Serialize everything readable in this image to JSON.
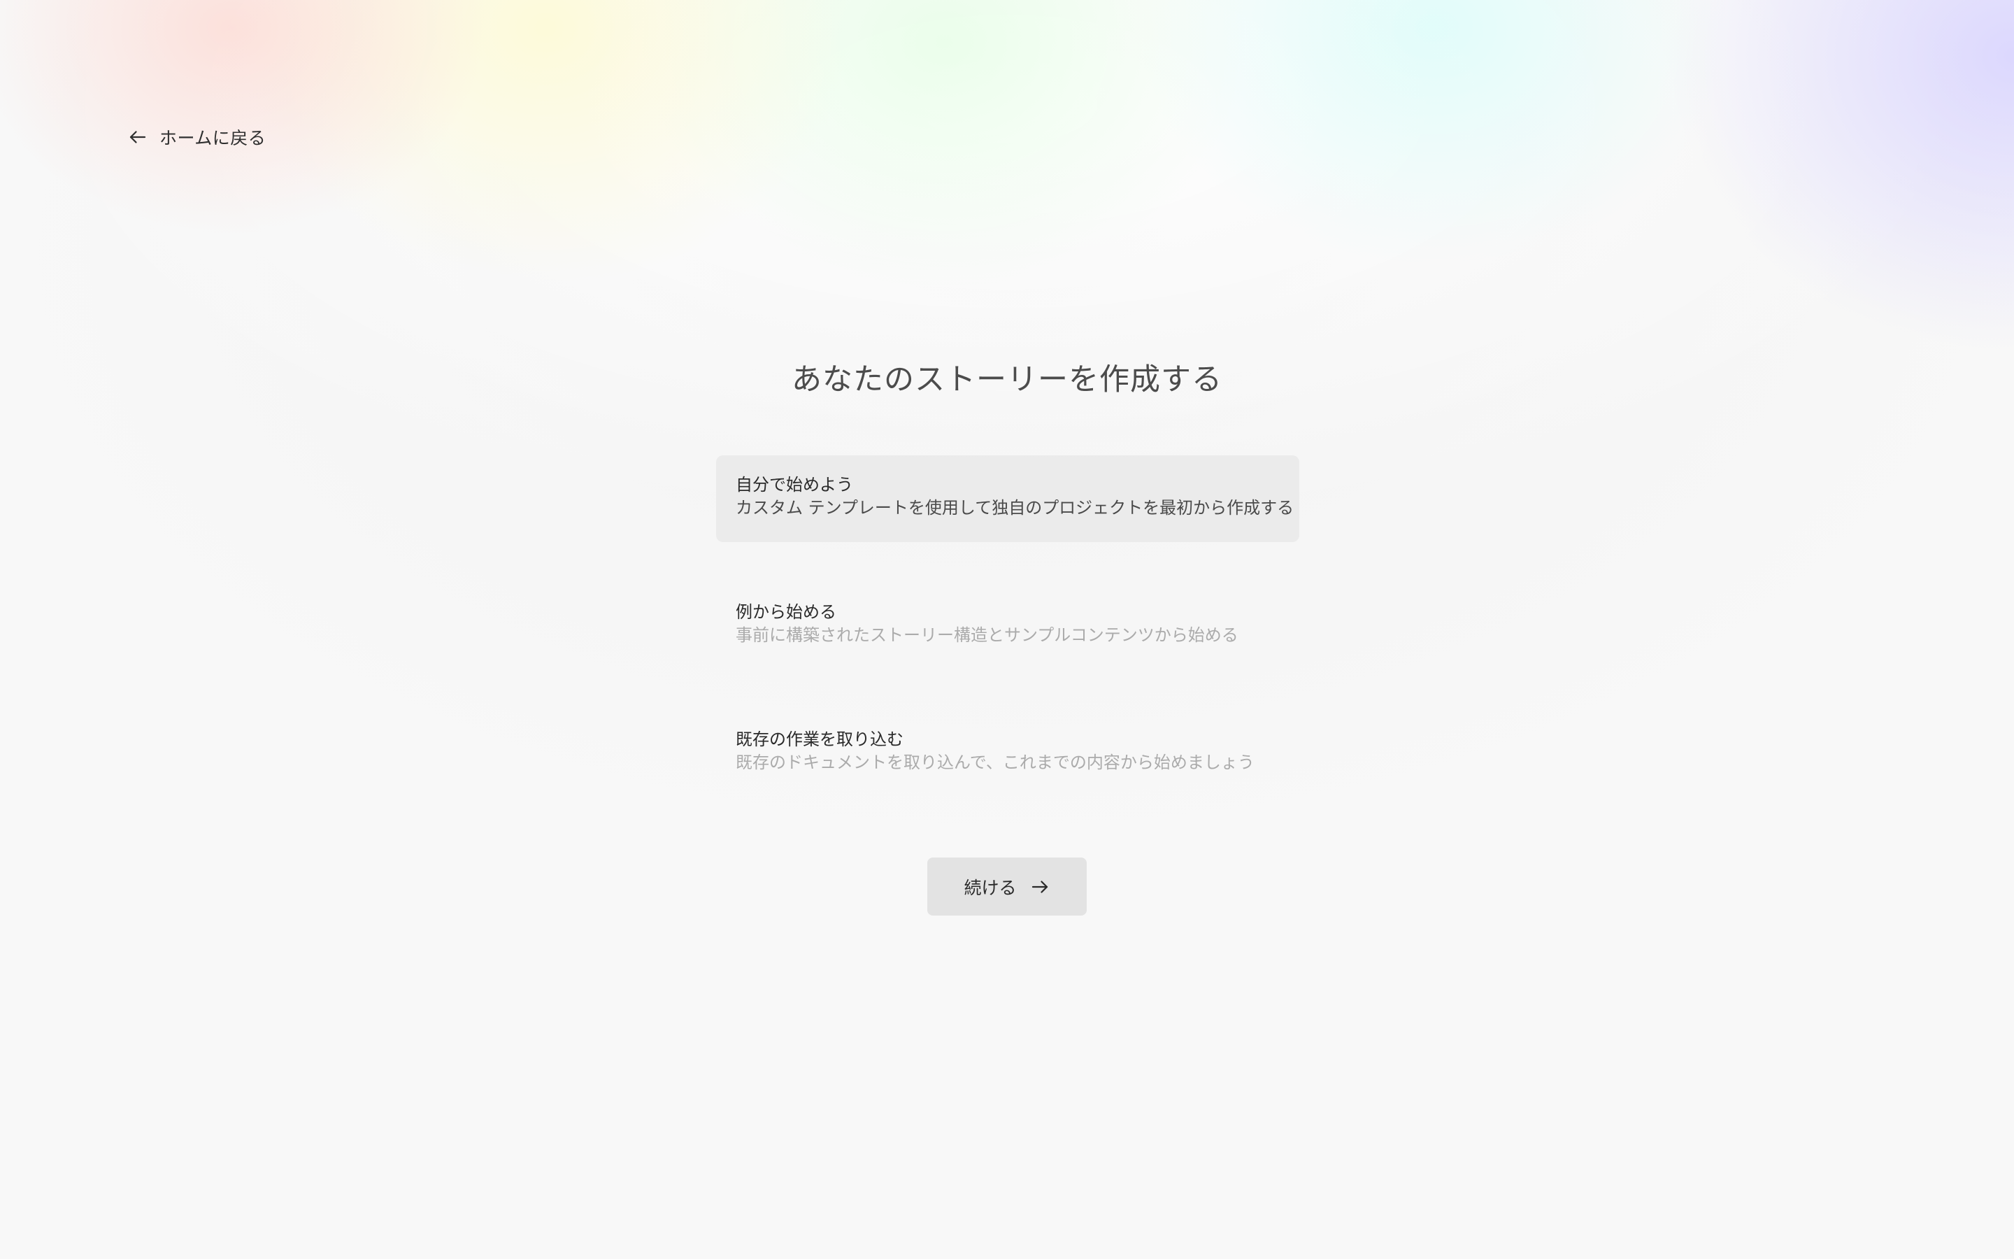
{
  "nav": {
    "back_label": "ホームに戻る",
    "back_icon": "arrow-left-icon"
  },
  "page": {
    "title": "あなたのストーリーを作成する"
  },
  "options": [
    {
      "title": "自分で始めよう",
      "description": "カスタム テンプレートを使用して独自のプロジェクトを最初から作成する",
      "selected": true
    },
    {
      "title": "例から始める",
      "description": "事前に構築されたストーリー構造とサンプルコンテンツから始める",
      "selected": false
    },
    {
      "title": "既存の作業を取り込む",
      "description": "既存のドキュメントを取り込んで、これまでの内容から始めましょう",
      "selected": false
    }
  ],
  "actions": {
    "continue_label": "続ける",
    "continue_icon": "arrow-right-icon"
  },
  "colors": {
    "background": "#f8f8f8",
    "selected_option_bg": "#ebebeb",
    "button_bg": "#e3e3e3",
    "muted_text": "#ababab",
    "title_text": "#4c4c4c"
  }
}
